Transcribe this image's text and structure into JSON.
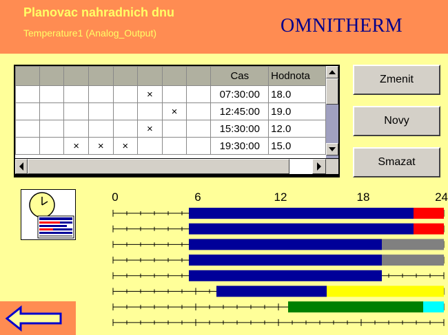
{
  "header": {
    "title": "Planovac nahradnich dnu",
    "subtitle": "Temperature1 (Analog_Output)",
    "brand": "OMNITHERM"
  },
  "table": {
    "time_header": "Cas",
    "value_header": "Hodnota",
    "rows": [
      {
        "marks": [
          "",
          "",
          "",
          "",
          "",
          "×",
          "",
          ""
        ],
        "time": "07:30:00",
        "value": "18.0"
      },
      {
        "marks": [
          "",
          "",
          "",
          "",
          "",
          "",
          "×",
          ""
        ],
        "time": "12:45:00",
        "value": "19.0"
      },
      {
        "marks": [
          "",
          "",
          "",
          "",
          "",
          "×",
          "",
          ""
        ],
        "time": "15:30:00",
        "value": "12.0"
      },
      {
        "marks": [
          "",
          "",
          "×",
          "×",
          "×",
          "",
          "",
          ""
        ],
        "time": "19:30:00",
        "value": "15.0"
      }
    ]
  },
  "buttons": {
    "change": "Zmenit",
    "new": "Novy",
    "delete": "Smazat"
  },
  "timeline": {
    "axis_labels": [
      "0",
      "6",
      "12",
      "18",
      "24"
    ],
    "hours_total": 24,
    "rows": [
      {
        "segments": [
          {
            "start": 5.5,
            "end": 21.8,
            "color": "#000099"
          },
          {
            "start": 21.8,
            "end": 24,
            "color": "#ff0000"
          }
        ]
      },
      {
        "segments": [
          {
            "start": 5.5,
            "end": 21.8,
            "color": "#000099"
          },
          {
            "start": 21.8,
            "end": 24,
            "color": "#ff0000"
          }
        ]
      },
      {
        "segments": [
          {
            "start": 5.5,
            "end": 19.5,
            "color": "#000099"
          },
          {
            "start": 19.5,
            "end": 24,
            "color": "#808080"
          }
        ]
      },
      {
        "segments": [
          {
            "start": 5.5,
            "end": 19.5,
            "color": "#000099"
          },
          {
            "start": 19.5,
            "end": 24,
            "color": "#808080"
          }
        ]
      },
      {
        "segments": [
          {
            "start": 5.5,
            "end": 19.5,
            "color": "#000099"
          }
        ]
      },
      {
        "segments": [
          {
            "start": 7.5,
            "end": 15.5,
            "color": "#000099"
          },
          {
            "start": 15.5,
            "end": 24,
            "color": "#ffff00"
          }
        ]
      },
      {
        "segments": [
          {
            "start": 12.7,
            "end": 22.5,
            "color": "#008000"
          },
          {
            "start": 22.5,
            "end": 24,
            "color": "#00ffff"
          }
        ]
      }
    ]
  },
  "icons": {
    "schedule": "clock-calendar-icon",
    "back": "back-arrow-icon"
  },
  "colors": {
    "background": "#ffff99",
    "header": "#ff8c52",
    "title_text": "#ffff66",
    "brand": "#00008b"
  }
}
